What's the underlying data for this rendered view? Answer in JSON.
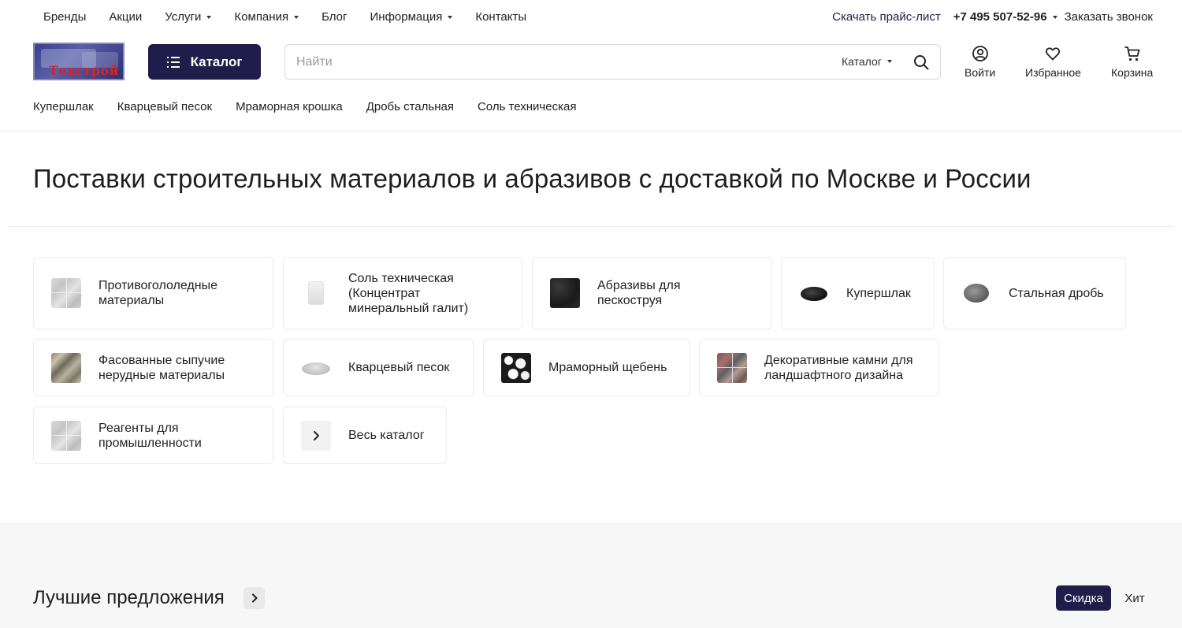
{
  "topnav": {
    "items": [
      {
        "label": "Бренды"
      },
      {
        "label": "Акции"
      },
      {
        "label": "Услуги",
        "dropdown": true
      },
      {
        "label": "Компания",
        "dropdown": true
      },
      {
        "label": "Блог"
      },
      {
        "label": "Информация",
        "dropdown": true
      },
      {
        "label": "Контакты"
      }
    ],
    "price_list_link": "Скачать прайс-лист",
    "phone": "+7 495 507-52-96",
    "callback": "Заказать звонок"
  },
  "header": {
    "logo_text": "Техстрой",
    "catalog_button": "Каталог",
    "search": {
      "placeholder": "Найти",
      "value": "",
      "scope": "Каталог"
    },
    "actions": {
      "login": "Войти",
      "favorites": "Избранное",
      "cart": "Корзина"
    }
  },
  "subnav": {
    "items": [
      "Купершлак",
      "Кварцевый песок",
      "Мраморная крошка",
      "Дробь стальная",
      "Соль техническая"
    ]
  },
  "page_title": "Поставки строительных материалов и абразивов с доставкой по Москве и России",
  "categories": [
    {
      "label": "Противогололедные материалы",
      "icon": "gray-stone-thumbnail"
    },
    {
      "label": "Соль техническая (Концентрат минеральный галит)",
      "icon": "salt-bag-thumbnail"
    },
    {
      "label": "Абразивы для пескоструя",
      "icon": "dark-abrasive-thumbnail"
    },
    {
      "label": "Купершлак",
      "icon": "black-pile-thumbnail"
    },
    {
      "label": "Стальная дробь",
      "icon": "gray-pile-thumbnail"
    },
    {
      "label": "Фасованные сыпучие нерудные материалы",
      "icon": "gravel-thumbnail"
    },
    {
      "label": "Кварцевый песок",
      "icon": "sand-pile-thumbnail"
    },
    {
      "label": "Мраморный щебень",
      "icon": "marble-chips-thumbnail"
    },
    {
      "label": "Декоративные камни для ландшафтного дизайна",
      "icon": "decorative-stone-thumbnail"
    },
    {
      "label": "Реагенты для промышленности",
      "icon": "gray-stone-thumbnail"
    },
    {
      "label": "Весь каталог",
      "icon": "chevron-right-icon"
    }
  ],
  "offers": {
    "title": "Лучшие предложения",
    "tabs": [
      {
        "label": "Скидка",
        "active": true
      },
      {
        "label": "Хит",
        "active": false
      }
    ]
  },
  "colors": {
    "brand_navy": "#1f1d4a",
    "logo_red": "#e02020"
  }
}
